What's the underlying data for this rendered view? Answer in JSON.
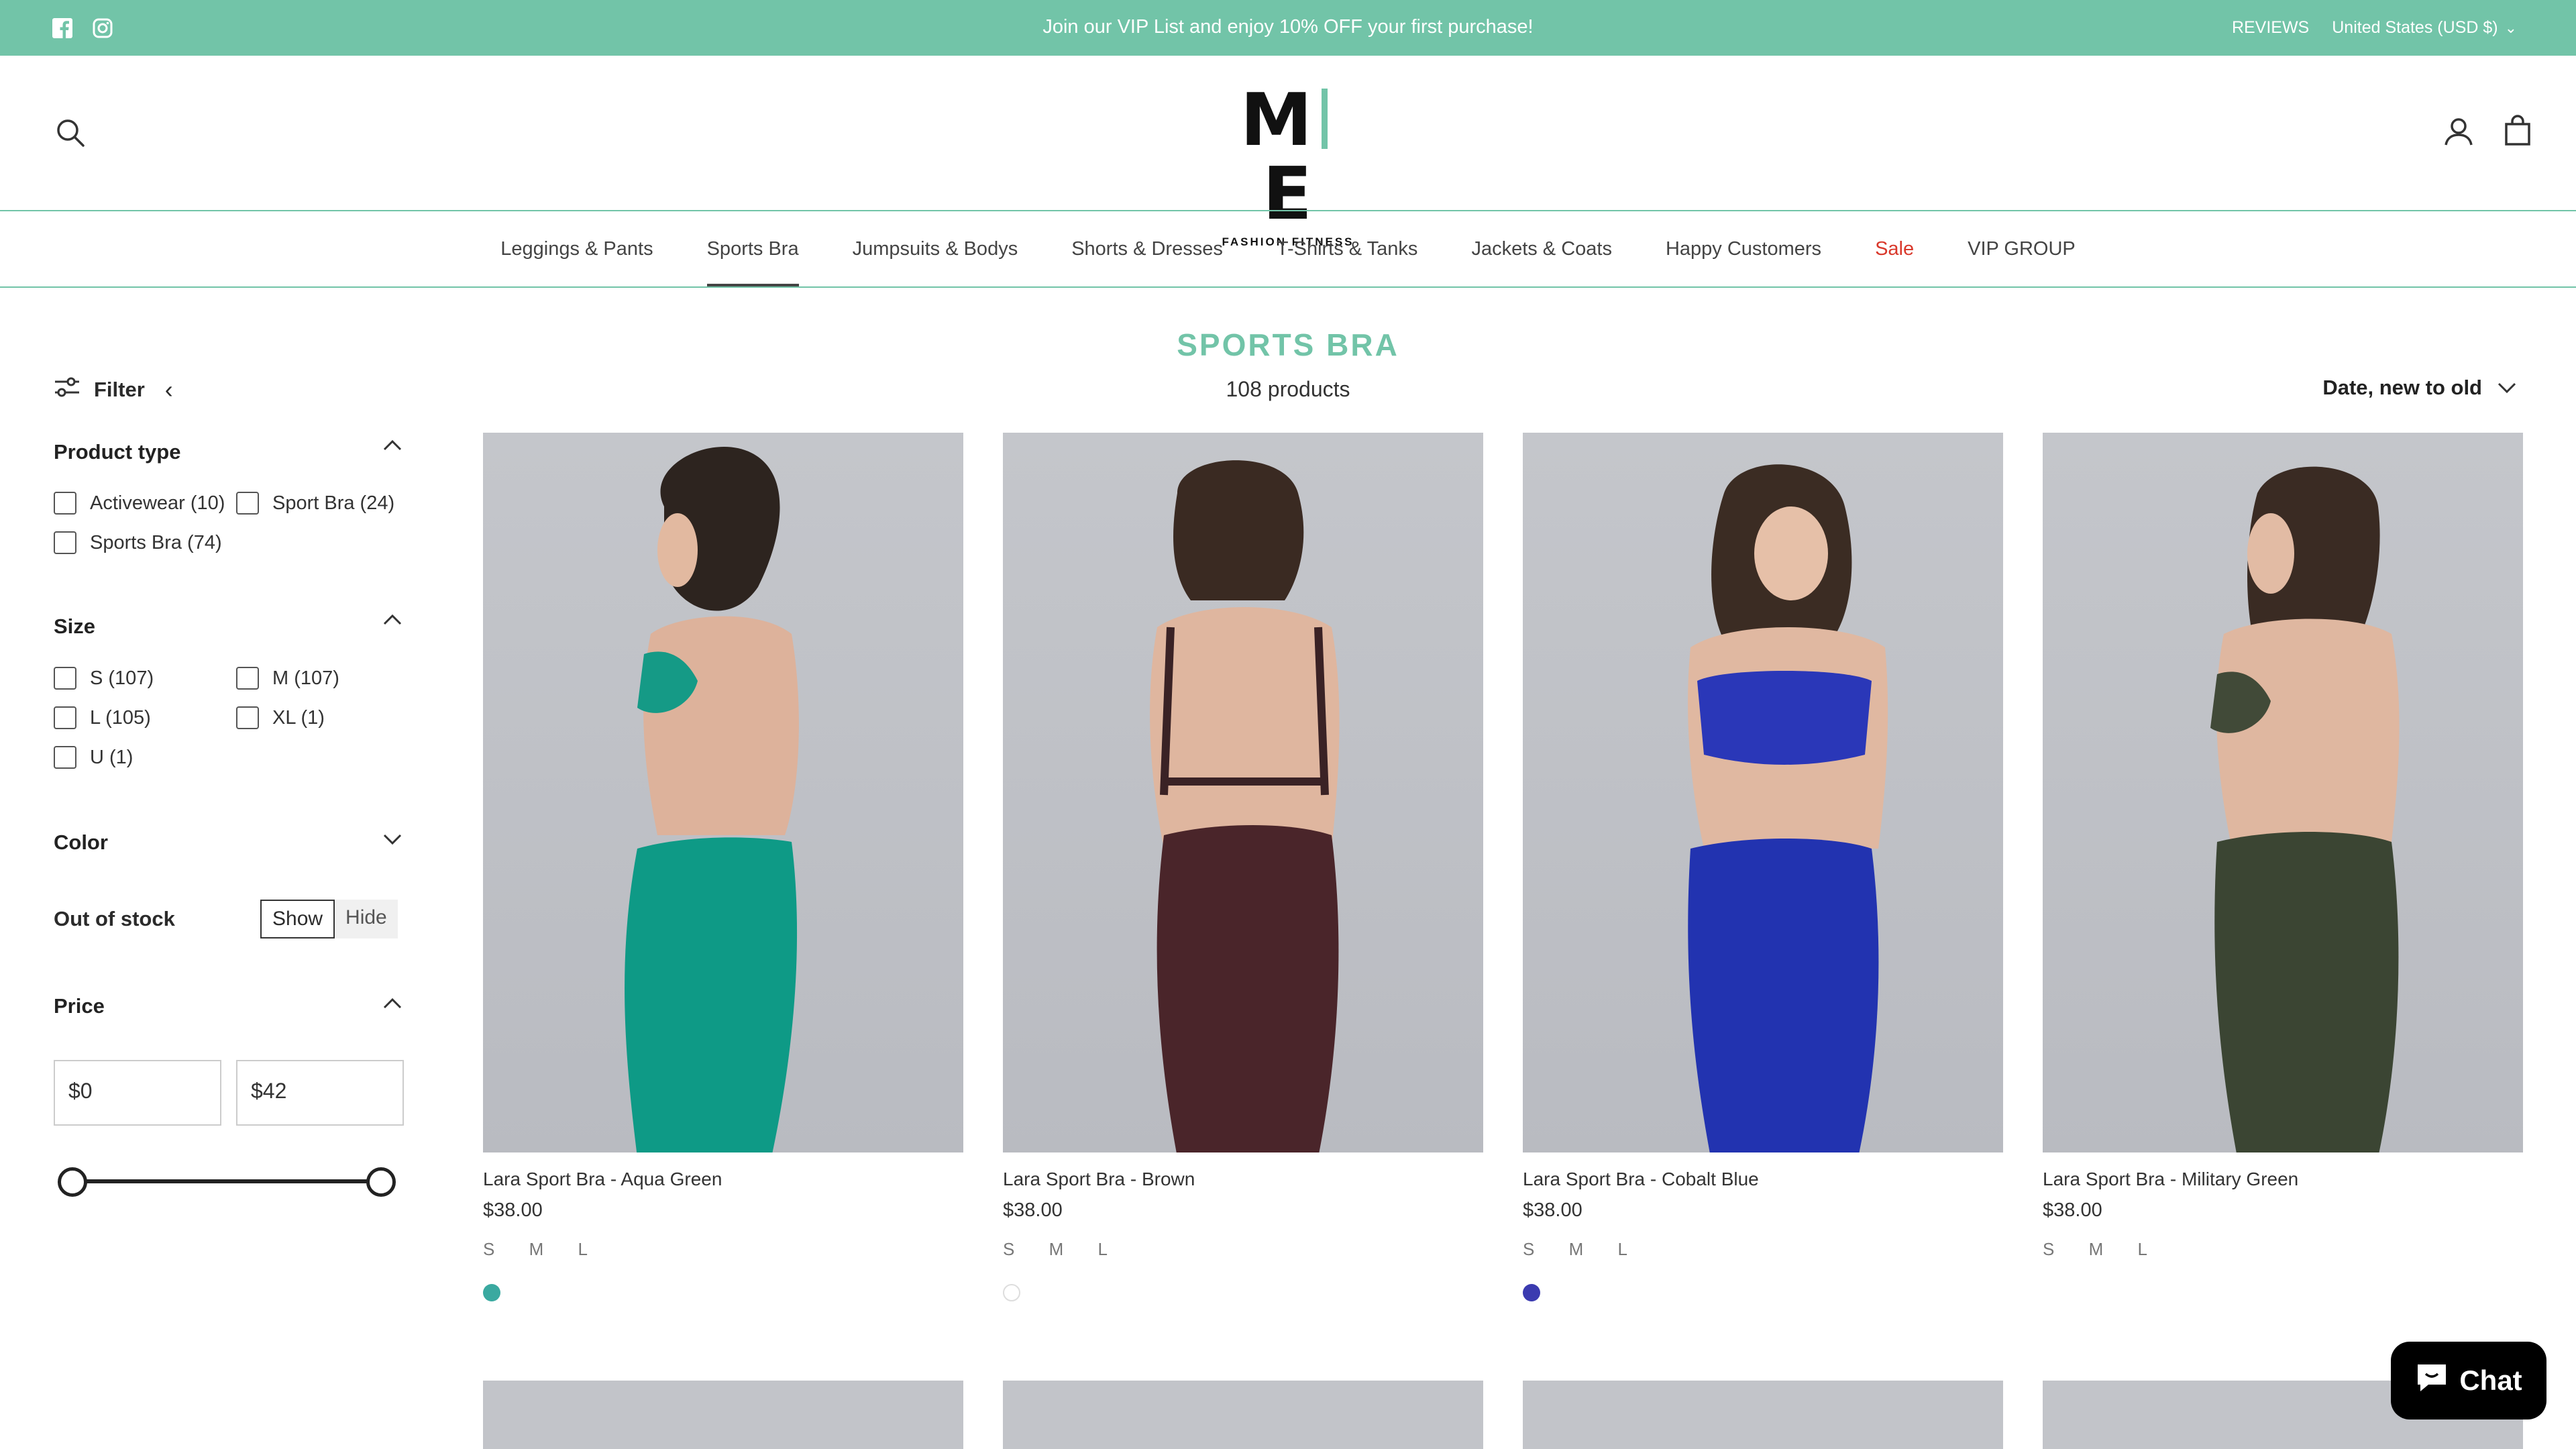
{
  "announcement": {
    "message": "Join our VIP List and enjoy 10% OFF your first purchase!",
    "reviews": "REVIEWS",
    "country": "United States (USD $)",
    "social": [
      "facebook-icon",
      "instagram-icon"
    ]
  },
  "logo": {
    "mark_left": "M",
    "mark_right": "E",
    "tagline": "FASHION FITNESS"
  },
  "nav": {
    "items": [
      "Leggings & Pants",
      "Sports Bra",
      "Jumpsuits & Bodys",
      "Shorts & Dresses",
      "T-Shirts & Tanks",
      "Jackets & Coats",
      "Happy Customers",
      "Sale",
      "VIP GROUP"
    ],
    "active": "Sports Bra"
  },
  "collection": {
    "title": "SPORTS BRA",
    "count": "108 products",
    "sort": "Date, new to old"
  },
  "filter": {
    "label": "Filter",
    "product_type": {
      "title": "Product type",
      "options": [
        "Activewear (10)",
        "Sport Bra (24)",
        "Sports Bra (74)"
      ]
    },
    "size": {
      "title": "Size",
      "options": [
        "S (107)",
        "M (107)",
        "L (105)",
        "XL (1)",
        "U (1)"
      ]
    },
    "color": {
      "title": "Color"
    },
    "out_of_stock": {
      "title": "Out of stock",
      "show": "Show",
      "hide": "Hide"
    },
    "price": {
      "title": "Price",
      "min": "0",
      "max": "42",
      "currency": "$"
    }
  },
  "products": [
    {
      "name": "Lara Sport Bra - Aqua Green",
      "price": "$38.00",
      "sizes": "S M L",
      "swatch": "#3aa9a0",
      "bra": "#159a86",
      "legging": "#0e9a86"
    },
    {
      "name": "Lara Sport Bra - Brown",
      "price": "$38.00",
      "sizes": "S M L",
      "swatch": "#ffffff",
      "bra": "#3a2225",
      "legging": "#4a252a"
    },
    {
      "name": "Lara Sport Bra - Cobalt Blue",
      "price": "$38.00",
      "sizes": "S M L",
      "swatch": "#3b3bb0",
      "bra": "#2a37b8",
      "legging": "#2233b0"
    },
    {
      "name": "Lara Sport Bra - Military Green",
      "price": "$38.00",
      "sizes": "S M L",
      "swatch": null,
      "bra": "#414a38",
      "legging": "#3b4533"
    }
  ],
  "chat": {
    "label": "Chat"
  }
}
